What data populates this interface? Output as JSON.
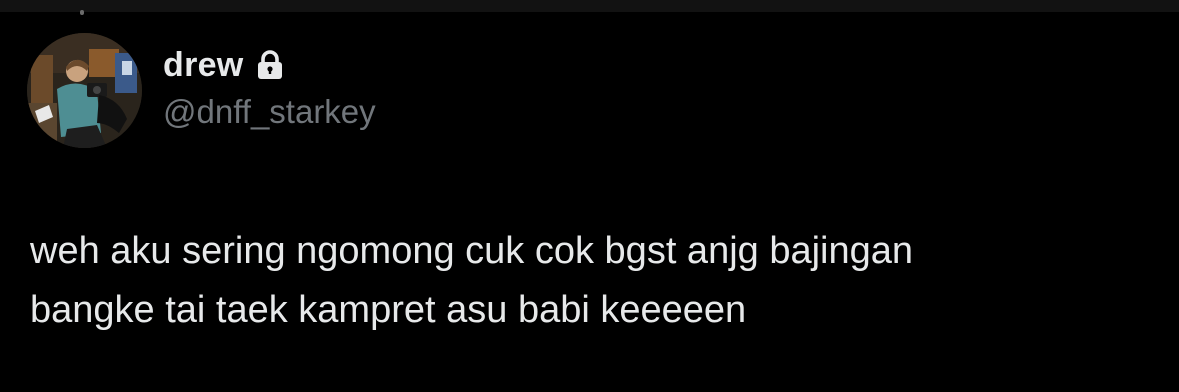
{
  "author": {
    "display_name": "drew",
    "handle": "@dnff_starkey",
    "protected_icon": "lock-icon",
    "avatar": "profile-photo"
  },
  "tweet": {
    "text": "weh aku sering ngomong cuk cok bgst anjg bajingan\nbangke tai taek kampret asu babi keeeeen"
  },
  "colors": {
    "background": "#000000",
    "primary_text": "#e7e9ea",
    "secondary_text": "#71767b"
  }
}
